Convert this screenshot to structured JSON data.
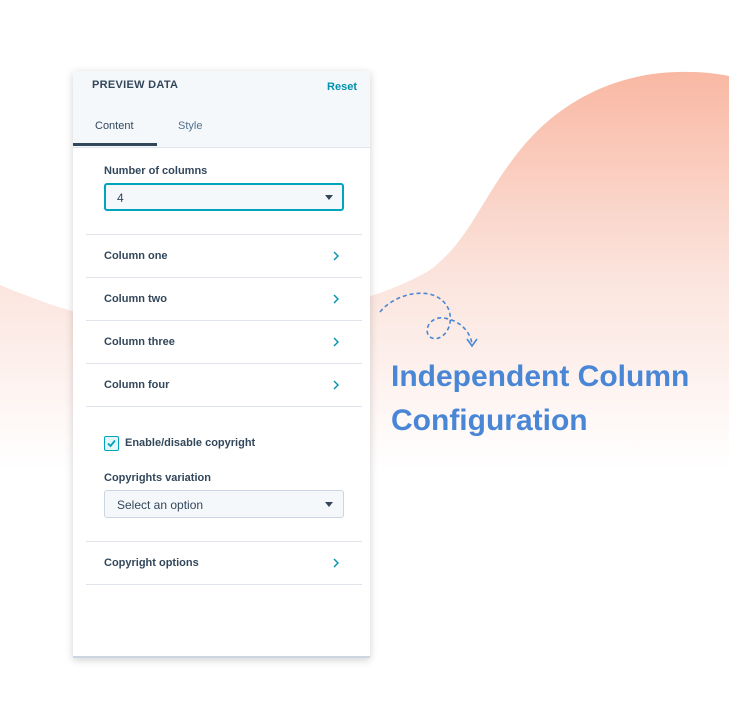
{
  "panel": {
    "title": "PREVIEW DATA",
    "reset_label": "Reset",
    "tabs": [
      {
        "label": "Content",
        "active": true
      },
      {
        "label": "Style",
        "active": false
      }
    ]
  },
  "columns_field": {
    "label": "Number of columns",
    "value": "4"
  },
  "column_rows": [
    {
      "label": "Column one"
    },
    {
      "label": "Column two"
    },
    {
      "label": "Column three"
    },
    {
      "label": "Column four"
    }
  ],
  "copyright": {
    "checkbox_label": "Enable/disable copyright",
    "checked": true,
    "variation_label": "Copyrights variation",
    "variation_placeholder": "Select an option",
    "options_label": "Copyright options"
  },
  "headline": {
    "line1": "Independent Column",
    "line2": "Configuration"
  },
  "colors": {
    "accent": "#00a4bd",
    "link": "#0091ae",
    "headline": "#4a86d6",
    "text": "#33475b",
    "wave": "#f9b8a3"
  }
}
